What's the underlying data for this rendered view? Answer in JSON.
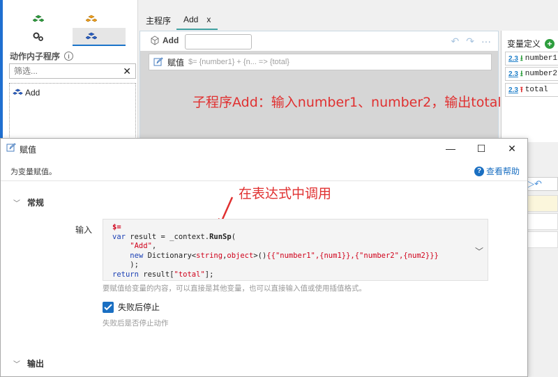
{
  "left_panel": {
    "section_title": "动作内子程序",
    "filter_placeholder": "筛选...",
    "sub_items": [
      {
        "label": "Add"
      }
    ]
  },
  "editor": {
    "tabs": [
      {
        "label": "主程序"
      },
      {
        "label": "Add",
        "close": "x"
      }
    ],
    "proc_name": "Add",
    "assign_label": "赋值",
    "assign_expr": "$= {number1} + {n... => {total}",
    "overflow": "···"
  },
  "variables": {
    "title": "变量定义",
    "rows": [
      {
        "type": "2.3",
        "direction": "in",
        "name": "number1"
      },
      {
        "type": "2.3",
        "direction": "in",
        "name": "number2"
      },
      {
        "type": "2.3",
        "direction": "out",
        "name": "total"
      }
    ]
  },
  "annotations": {
    "top": "子程序Add：输入number1、number2，输出total",
    "middle": "在表达式中调用"
  },
  "dialog": {
    "title": "赋值",
    "subtitle": "为变量赋值。",
    "help": "查看帮助",
    "section_general": "常规",
    "input_label": "输入",
    "code_lines": [
      "$=",
      "var result = _context.RunSp(",
      "    \"Add\",",
      "    new Dictionary<string,object>(){{\"number1\",{num1}},{\"number2\",{num2}}}",
      "    );",
      "return result[\"total\"];"
    ],
    "input_hint": "要赋值给变量的内容，可以直接是其他变量，也可以直接输入值或使用插值格式。",
    "stop_label": "失败后停止",
    "stop_checked": true,
    "stop_hint": "失败后是否停止动作",
    "section_output": "输出"
  },
  "colors": {
    "accent": "#1a6fc2",
    "annotation": "#e03030",
    "green": "#2e9e3e"
  }
}
